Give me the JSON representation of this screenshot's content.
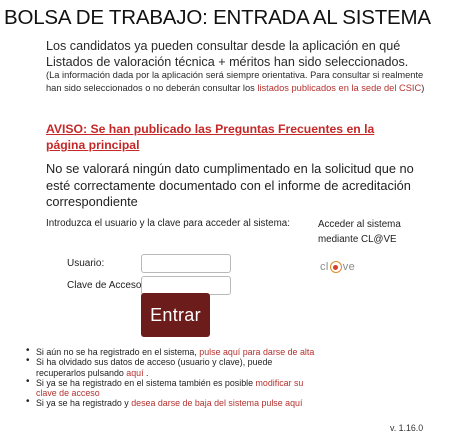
{
  "page": {
    "title": "BOLSA DE TRABAJO: ENTRADA AL SISTEMA",
    "intro": "Los candidatos ya pueden consultar desde la aplicación en qué Listados de valoración técnica + méritos han sido seleccionados.",
    "note_prefix": "(La información dada por la aplicación será siempre orientativa. Para consultar si realmente han sido seleccionados o no deberán consultar los ",
    "note_link": "listados publicados en la sede del CSIC",
    "note_suffix": ")",
    "aviso": "AVISO: Se han publicado las Preguntas Frecuentes en la página principal",
    "warning": "No se valorará ningún dato cumplimentado en la solicitud que no esté correctamente documentado con el informe de acreditación correspondiente"
  },
  "login": {
    "prompt": "Introduzca el usuario y la clave para acceder al sistema:",
    "user_label": "Usuario:",
    "user_value": "",
    "password_label": "Clave de Acceso:",
    "password_value": "",
    "submit_label": "Entrar"
  },
  "clave": {
    "text": "Acceder al sistema mediante CL@VE",
    "logo_left": "cl",
    "logo_right": "ve"
  },
  "links": [
    {
      "text": "Si aún no se ha registrado en el sistema, ",
      "link": "pulse aquí para darse de alta",
      "after": ""
    },
    {
      "text": "Si ha olvidado sus datos de acceso (usuario y clave), puede recuperarlos pulsando ",
      "link": "aquí",
      "after": " ."
    },
    {
      "text": "Si ya se ha registrado en el sistema también es posible ",
      "link": "modificar su clave de acceso",
      "after": ""
    },
    {
      "text": "Si ya se ha registrado y ",
      "link": "desea darse de baja del sistema pulse aquí",
      "after": ""
    }
  ],
  "version": "v. 1.16.0",
  "colors": {
    "link": "#b4322f",
    "aviso": "#c62828",
    "button": "#6d1c1c"
  }
}
